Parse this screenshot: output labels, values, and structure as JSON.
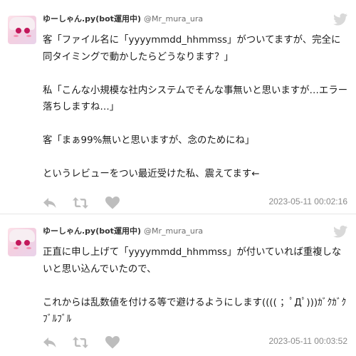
{
  "tweets": [
    {
      "display_name": "ゆーしゃん.py(bot運用中)",
      "handle": "@Mr_mura_ura",
      "body": "客「ファイル名に「yyyymmdd_hhmmss」がついてますが、完全に同タイミングで動かしたらどうなります？」\n\n私「こんな小規模な社内システムでそんな事無いと思いますが…エラー落ちしますね…」\n\n客「まぁ99%無いと思いますが、念のためにね」\n\nというレビューをつい最近受けた私、震えてます←",
      "timestamp": "2023-05-11 00:02:16",
      "icons": {
        "platform": "twitter-bird-icon",
        "reply": "reply-icon",
        "retweet": "retweet-icon",
        "like": "heart-icon"
      }
    },
    {
      "display_name": "ゆーしゃん.py(bot運用中)",
      "handle": "@Mr_mura_ura",
      "body": "正直に申し上げて「yyyymmdd_hhmmss」が付いていれば重複しないと思い込んでいたので、\n\nこれからは乱数値を付ける等で避けるようにします(((( ；ﾟДﾟ)))ｶﾞｸｶﾞｸﾌﾞﾙﾌﾞﾙ",
      "timestamp": "2023-05-11 00:03:52",
      "icons": {
        "platform": "twitter-bird-icon",
        "reply": "reply-icon",
        "retweet": "retweet-icon",
        "like": "heart-icon"
      }
    }
  ],
  "colors": {
    "text": "#1a1a1a",
    "muted": "#8a8a8a",
    "icon": "#bdbdbd",
    "divider": "#e6e6e6",
    "bird": "#d9d9d9"
  }
}
